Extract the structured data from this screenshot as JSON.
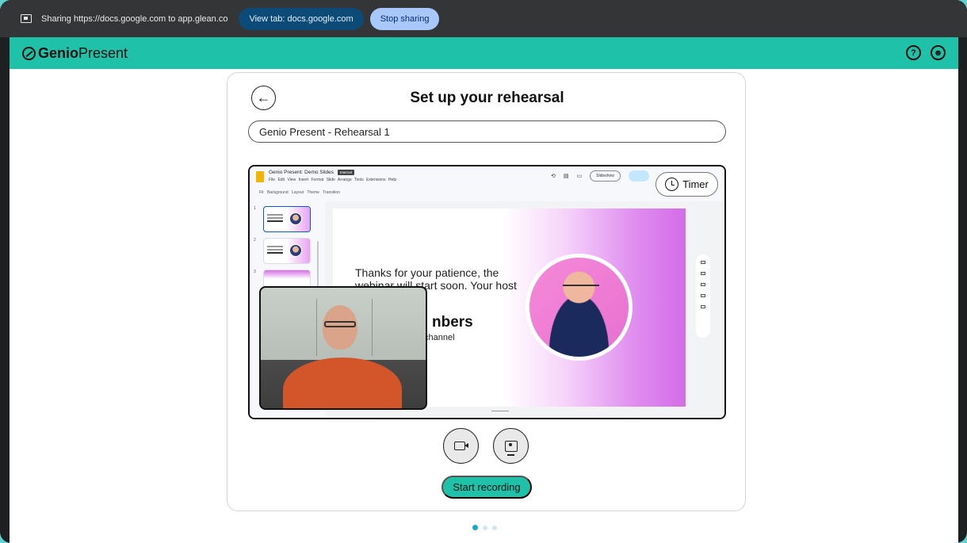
{
  "share_bar": {
    "text": "Sharing https://docs.google.com to app.glean.co",
    "view_tab_label": "View tab: docs.google.com",
    "stop_sharing_label": "Stop sharing"
  },
  "app_header": {
    "brand_bold": "Genio",
    "brand_light": "Present",
    "help_icon": "help-icon",
    "account_icon": "account-icon"
  },
  "setup": {
    "title": "Set up your rehearsal",
    "rehearsal_name": "Genio Present - Rehearsal 1",
    "start_recording_label": "Start recording",
    "timer_label": "Timer"
  },
  "slides_app": {
    "doc_title": "Genio Present: Demo Slides",
    "badge": "Internal",
    "menu": "File Edit View Insert Format Slide Arrange Tools Extensions Help",
    "toolbar": "Fit Background Layout Theme Transition",
    "slideshow_label": "Slideshow",
    "thumb_numbers": [
      "1",
      "2",
      "3"
    ]
  },
  "slide": {
    "body_text": "Thanks for your patience, the webinar will start soon. Your host will be:",
    "name_fragment": "nbers",
    "sub_fragment": "channel"
  },
  "pagination": {
    "total": 3,
    "active_index": 0
  },
  "colors": {
    "accent": "#1fc1a8",
    "share_bar": "#333537",
    "view_pill": "#0c4a78",
    "stop_pill": "#a8c7fa",
    "dot_active": "#16a9c8"
  }
}
